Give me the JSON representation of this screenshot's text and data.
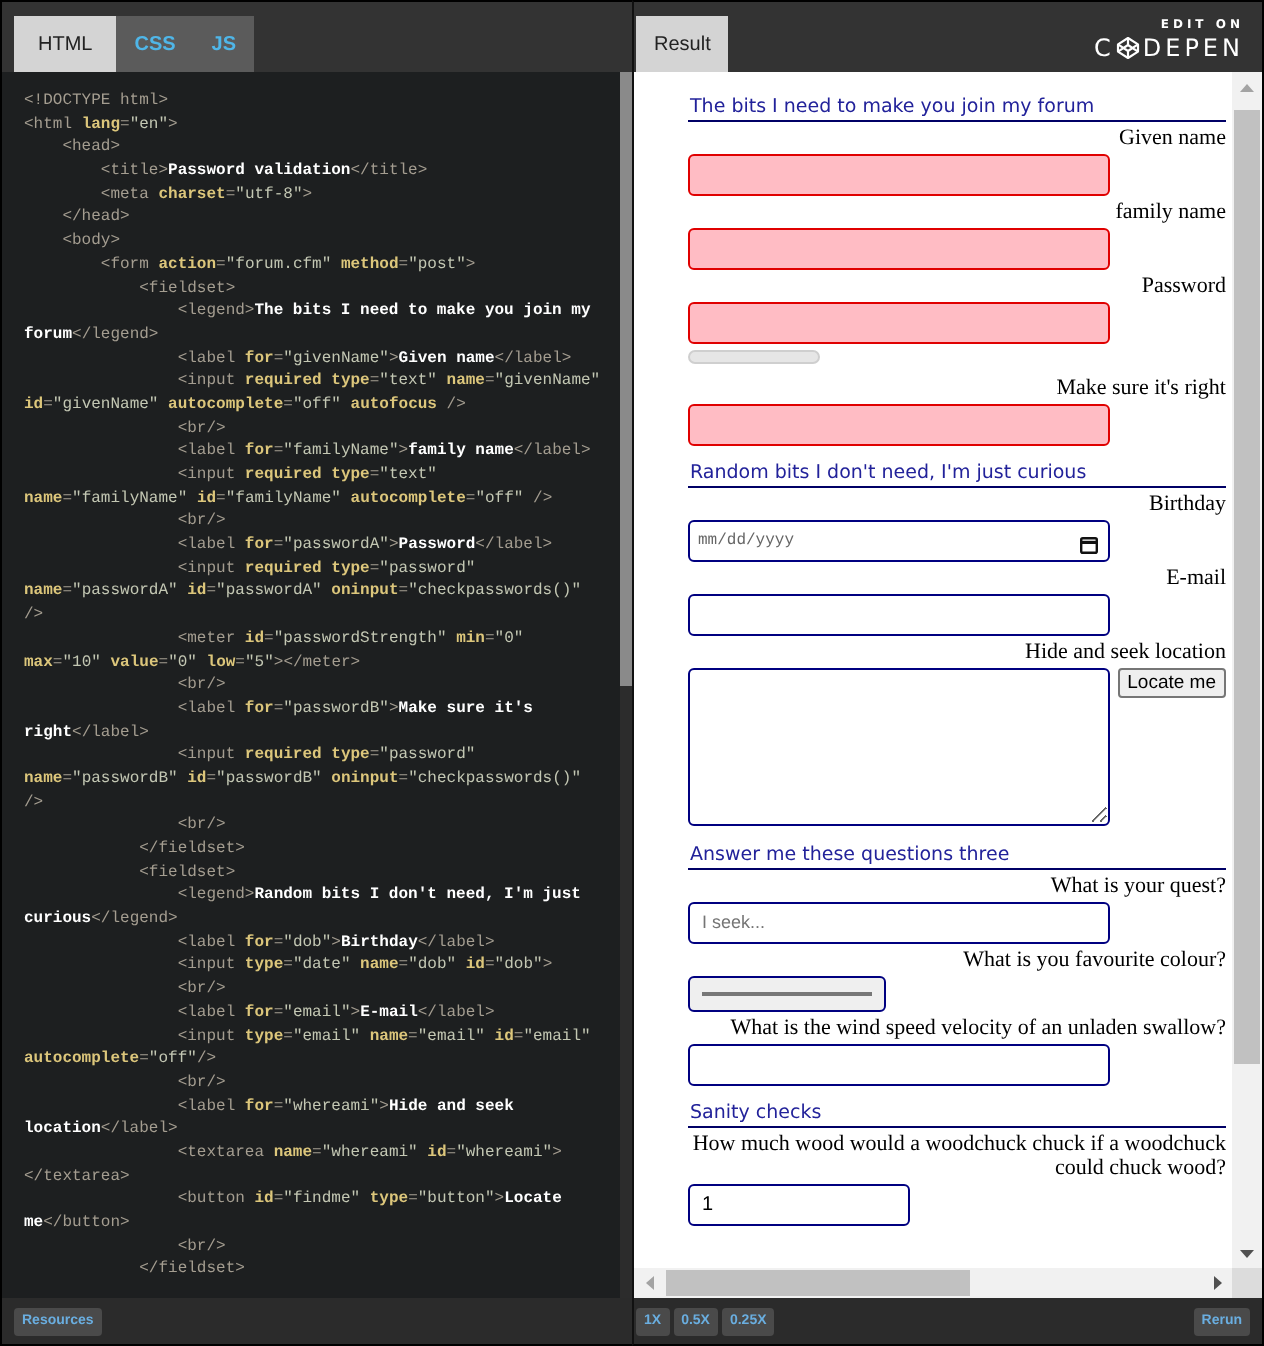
{
  "editor": {
    "tabs": [
      {
        "label": "HTML",
        "selected": true
      },
      {
        "label": "CSS",
        "selected": false
      },
      {
        "label": "JS",
        "selected": false
      }
    ],
    "code_lines": [
      [
        {
          "kind": "tag",
          "text": "<!DOCTYPE html>"
        }
      ],
      [
        {
          "kind": "tag",
          "text": "<html "
        },
        {
          "kind": "attr",
          "text": "lang"
        },
        {
          "kind": "tag",
          "text": "="
        },
        {
          "kind": "str",
          "text": "\"en\""
        },
        {
          "kind": "tag",
          "text": ">"
        }
      ],
      [
        {
          "kind": "tag",
          "text": "    <head>"
        }
      ],
      [
        {
          "kind": "tag",
          "text": "        <title>"
        },
        {
          "kind": "text",
          "text": "Password validation"
        },
        {
          "kind": "tag",
          "text": "</title>"
        }
      ],
      [
        {
          "kind": "tag",
          "text": "        <meta "
        },
        {
          "kind": "attr",
          "text": "charset"
        },
        {
          "kind": "tag",
          "text": "="
        },
        {
          "kind": "str",
          "text": "\"utf-8\""
        },
        {
          "kind": "tag",
          "text": ">"
        }
      ],
      [
        {
          "kind": "tag",
          "text": "    </head>"
        }
      ],
      [
        {
          "kind": "tag",
          "text": "    <body>"
        }
      ],
      [
        {
          "kind": "tag",
          "text": "        <form "
        },
        {
          "kind": "attr",
          "text": "action"
        },
        {
          "kind": "tag",
          "text": "="
        },
        {
          "kind": "str",
          "text": "\"forum.cfm\" "
        },
        {
          "kind": "attr",
          "text": "method"
        },
        {
          "kind": "tag",
          "text": "="
        },
        {
          "kind": "str",
          "text": "\"post\""
        },
        {
          "kind": "tag",
          "text": ">"
        }
      ],
      [
        {
          "kind": "tag",
          "text": "            <fieldset>"
        }
      ],
      [
        {
          "kind": "tag",
          "text": "                <legend>"
        },
        {
          "kind": "text",
          "text": "The bits I need to make you join my"
        }
      ],
      [
        {
          "kind": "text",
          "text": "forum"
        },
        {
          "kind": "tag",
          "text": "</legend>"
        }
      ],
      [
        {
          "kind": "tag",
          "text": "                <label "
        },
        {
          "kind": "attr",
          "text": "for"
        },
        {
          "kind": "tag",
          "text": "="
        },
        {
          "kind": "str",
          "text": "\"givenName\""
        },
        {
          "kind": "tag",
          "text": ">"
        },
        {
          "kind": "text",
          "text": "Given name"
        },
        {
          "kind": "tag",
          "text": "</label>"
        }
      ],
      [
        {
          "kind": "tag",
          "text": "                <input "
        },
        {
          "kind": "attr",
          "text": "required "
        },
        {
          "kind": "attr",
          "text": "type"
        },
        {
          "kind": "tag",
          "text": "="
        },
        {
          "kind": "str",
          "text": "\"text\" "
        },
        {
          "kind": "attr",
          "text": "name"
        },
        {
          "kind": "tag",
          "text": "="
        },
        {
          "kind": "str",
          "text": "\"givenName\""
        }
      ],
      [
        {
          "kind": "attr",
          "text": "id"
        },
        {
          "kind": "tag",
          "text": "="
        },
        {
          "kind": "str",
          "text": "\"givenName\" "
        },
        {
          "kind": "attr",
          "text": "autocomplete"
        },
        {
          "kind": "tag",
          "text": "="
        },
        {
          "kind": "str",
          "text": "\"off\" "
        },
        {
          "kind": "attr",
          "text": "autofocus"
        },
        {
          "kind": "tag",
          "text": " />"
        }
      ],
      [
        {
          "kind": "tag",
          "text": "                <br/>"
        }
      ],
      [
        {
          "kind": "tag",
          "text": "                <label "
        },
        {
          "kind": "attr",
          "text": "for"
        },
        {
          "kind": "tag",
          "text": "="
        },
        {
          "kind": "str",
          "text": "\"familyName\""
        },
        {
          "kind": "tag",
          "text": ">"
        },
        {
          "kind": "text",
          "text": "family name"
        },
        {
          "kind": "tag",
          "text": "</label>"
        }
      ],
      [
        {
          "kind": "tag",
          "text": "                <input "
        },
        {
          "kind": "attr",
          "text": "required "
        },
        {
          "kind": "attr",
          "text": "type"
        },
        {
          "kind": "tag",
          "text": "="
        },
        {
          "kind": "str",
          "text": "\"text\""
        }
      ],
      [
        {
          "kind": "attr",
          "text": "name"
        },
        {
          "kind": "tag",
          "text": "="
        },
        {
          "kind": "str",
          "text": "\"familyName\" "
        },
        {
          "kind": "attr",
          "text": "id"
        },
        {
          "kind": "tag",
          "text": "="
        },
        {
          "kind": "str",
          "text": "\"familyName\" "
        },
        {
          "kind": "attr",
          "text": "autocomplete"
        },
        {
          "kind": "tag",
          "text": "="
        },
        {
          "kind": "str",
          "text": "\"off\""
        },
        {
          "kind": "tag",
          "text": " />"
        }
      ],
      [
        {
          "kind": "tag",
          "text": "                <br/>"
        }
      ],
      [
        {
          "kind": "tag",
          "text": "                <label "
        },
        {
          "kind": "attr",
          "text": "for"
        },
        {
          "kind": "tag",
          "text": "="
        },
        {
          "kind": "str",
          "text": "\"passwordA\""
        },
        {
          "kind": "tag",
          "text": ">"
        },
        {
          "kind": "text",
          "text": "Password"
        },
        {
          "kind": "tag",
          "text": "</label>"
        }
      ],
      [
        {
          "kind": "tag",
          "text": "                <input "
        },
        {
          "kind": "attr",
          "text": "required "
        },
        {
          "kind": "attr",
          "text": "type"
        },
        {
          "kind": "tag",
          "text": "="
        },
        {
          "kind": "str",
          "text": "\"password\""
        }
      ],
      [
        {
          "kind": "attr",
          "text": "name"
        },
        {
          "kind": "tag",
          "text": "="
        },
        {
          "kind": "str",
          "text": "\"passwordA\" "
        },
        {
          "kind": "attr",
          "text": "id"
        },
        {
          "kind": "tag",
          "text": "="
        },
        {
          "kind": "str",
          "text": "\"passwordA\" "
        },
        {
          "kind": "attr",
          "text": "oninput"
        },
        {
          "kind": "tag",
          "text": "="
        },
        {
          "kind": "str",
          "text": "\"checkpasswords()\""
        }
      ],
      [
        {
          "kind": "tag",
          "text": "/>"
        }
      ],
      [
        {
          "kind": "tag",
          "text": "                <meter "
        },
        {
          "kind": "attr",
          "text": "id"
        },
        {
          "kind": "tag",
          "text": "="
        },
        {
          "kind": "str",
          "text": "\"passwordStrength\" "
        },
        {
          "kind": "attr",
          "text": "min"
        },
        {
          "kind": "tag",
          "text": "="
        },
        {
          "kind": "str",
          "text": "\"0\""
        }
      ],
      [
        {
          "kind": "attr",
          "text": "max"
        },
        {
          "kind": "tag",
          "text": "="
        },
        {
          "kind": "str",
          "text": "\"10\" "
        },
        {
          "kind": "attr",
          "text": "value"
        },
        {
          "kind": "tag",
          "text": "="
        },
        {
          "kind": "str",
          "text": "\"0\" "
        },
        {
          "kind": "attr",
          "text": "low"
        },
        {
          "kind": "tag",
          "text": "="
        },
        {
          "kind": "str",
          "text": "\"5\""
        },
        {
          "kind": "tag",
          "text": "></meter>"
        }
      ],
      [
        {
          "kind": "tag",
          "text": "                <br/>"
        }
      ],
      [
        {
          "kind": "tag",
          "text": "                <label "
        },
        {
          "kind": "attr",
          "text": "for"
        },
        {
          "kind": "tag",
          "text": "="
        },
        {
          "kind": "str",
          "text": "\"passwordB\""
        },
        {
          "kind": "tag",
          "text": ">"
        },
        {
          "kind": "text",
          "text": "Make sure it's"
        }
      ],
      [
        {
          "kind": "text",
          "text": "right"
        },
        {
          "kind": "tag",
          "text": "</label>"
        }
      ],
      [
        {
          "kind": "tag",
          "text": "                <input "
        },
        {
          "kind": "attr",
          "text": "required "
        },
        {
          "kind": "attr",
          "text": "type"
        },
        {
          "kind": "tag",
          "text": "="
        },
        {
          "kind": "str",
          "text": "\"password\""
        }
      ],
      [
        {
          "kind": "attr",
          "text": "name"
        },
        {
          "kind": "tag",
          "text": "="
        },
        {
          "kind": "str",
          "text": "\"passwordB\" "
        },
        {
          "kind": "attr",
          "text": "id"
        },
        {
          "kind": "tag",
          "text": "="
        },
        {
          "kind": "str",
          "text": "\"passwordB\" "
        },
        {
          "kind": "attr",
          "text": "oninput"
        },
        {
          "kind": "tag",
          "text": "="
        },
        {
          "kind": "str",
          "text": "\"checkpasswords()\""
        }
      ],
      [
        {
          "kind": "tag",
          "text": "/>"
        }
      ],
      [
        {
          "kind": "tag",
          "text": "                <br/>"
        }
      ],
      [
        {
          "kind": "tag",
          "text": "            </fieldset>"
        }
      ],
      [
        {
          "kind": "tag",
          "text": "            <fieldset>"
        }
      ],
      [
        {
          "kind": "tag",
          "text": "                <legend>"
        },
        {
          "kind": "text",
          "text": "Random bits I don't need, I'm just"
        }
      ],
      [
        {
          "kind": "text",
          "text": "curious"
        },
        {
          "kind": "tag",
          "text": "</legend>"
        }
      ],
      [
        {
          "kind": "tag",
          "text": "                <label "
        },
        {
          "kind": "attr",
          "text": "for"
        },
        {
          "kind": "tag",
          "text": "="
        },
        {
          "kind": "str",
          "text": "\"dob\""
        },
        {
          "kind": "tag",
          "text": ">"
        },
        {
          "kind": "text",
          "text": "Birthday"
        },
        {
          "kind": "tag",
          "text": "</label>"
        }
      ],
      [
        {
          "kind": "tag",
          "text": "                <input "
        },
        {
          "kind": "attr",
          "text": "type"
        },
        {
          "kind": "tag",
          "text": "="
        },
        {
          "kind": "str",
          "text": "\"date\" "
        },
        {
          "kind": "attr",
          "text": "name"
        },
        {
          "kind": "tag",
          "text": "="
        },
        {
          "kind": "str",
          "text": "\"dob\" "
        },
        {
          "kind": "attr",
          "text": "id"
        },
        {
          "kind": "tag",
          "text": "="
        },
        {
          "kind": "str",
          "text": "\"dob\""
        },
        {
          "kind": "tag",
          "text": ">"
        }
      ],
      [
        {
          "kind": "tag",
          "text": "                <br/>"
        }
      ],
      [
        {
          "kind": "tag",
          "text": "                <label "
        },
        {
          "kind": "attr",
          "text": "for"
        },
        {
          "kind": "tag",
          "text": "="
        },
        {
          "kind": "str",
          "text": "\"email\""
        },
        {
          "kind": "tag",
          "text": ">"
        },
        {
          "kind": "text",
          "text": "E-mail"
        },
        {
          "kind": "tag",
          "text": "</label>"
        }
      ],
      [
        {
          "kind": "tag",
          "text": "                <input "
        },
        {
          "kind": "attr",
          "text": "type"
        },
        {
          "kind": "tag",
          "text": "="
        },
        {
          "kind": "str",
          "text": "\"email\" "
        },
        {
          "kind": "attr",
          "text": "name"
        },
        {
          "kind": "tag",
          "text": "="
        },
        {
          "kind": "str",
          "text": "\"email\" "
        },
        {
          "kind": "attr",
          "text": "id"
        },
        {
          "kind": "tag",
          "text": "="
        },
        {
          "kind": "str",
          "text": "\"email\""
        }
      ],
      [
        {
          "kind": "attr",
          "text": "autocomplete"
        },
        {
          "kind": "tag",
          "text": "="
        },
        {
          "kind": "str",
          "text": "\"off\""
        },
        {
          "kind": "tag",
          "text": "/>"
        }
      ],
      [
        {
          "kind": "tag",
          "text": "                <br/>"
        }
      ],
      [
        {
          "kind": "tag",
          "text": "                <label "
        },
        {
          "kind": "attr",
          "text": "for"
        },
        {
          "kind": "tag",
          "text": "="
        },
        {
          "kind": "str",
          "text": "\"whereami\""
        },
        {
          "kind": "tag",
          "text": ">"
        },
        {
          "kind": "text",
          "text": "Hide and seek"
        }
      ],
      [
        {
          "kind": "text",
          "text": "location"
        },
        {
          "kind": "tag",
          "text": "</label>"
        }
      ],
      [
        {
          "kind": "tag",
          "text": "                <textarea "
        },
        {
          "kind": "attr",
          "text": "name"
        },
        {
          "kind": "tag",
          "text": "="
        },
        {
          "kind": "str",
          "text": "\"whereami\" "
        },
        {
          "kind": "attr",
          "text": "id"
        },
        {
          "kind": "tag",
          "text": "="
        },
        {
          "kind": "str",
          "text": "\"whereami\""
        },
        {
          "kind": "tag",
          "text": ">"
        }
      ],
      [
        {
          "kind": "tag",
          "text": "</textarea>"
        }
      ],
      [
        {
          "kind": "tag",
          "text": "                <button "
        },
        {
          "kind": "attr",
          "text": "id"
        },
        {
          "kind": "tag",
          "text": "="
        },
        {
          "kind": "str",
          "text": "\"findme\" "
        },
        {
          "kind": "attr",
          "text": "type"
        },
        {
          "kind": "tag",
          "text": "="
        },
        {
          "kind": "str",
          "text": "\"button\""
        },
        {
          "kind": "tag",
          "text": ">"
        },
        {
          "kind": "text",
          "text": "Locate"
        }
      ],
      [
        {
          "kind": "text",
          "text": "me"
        },
        {
          "kind": "tag",
          "text": "</button>"
        }
      ],
      [
        {
          "kind": "tag",
          "text": "                <br/>"
        }
      ],
      [
        {
          "kind": "tag",
          "text": "            </fieldset>"
        }
      ]
    ],
    "resources_button": "Resources"
  },
  "result": {
    "tabs": [
      {
        "label": "Result",
        "selected": true
      }
    ],
    "edit_on": "EDIT ON",
    "logo_left": "C",
    "logo_right": "DEPEN",
    "fieldsets": [
      {
        "legend": "The bits I need to make you join my forum",
        "fields": [
          {
            "kind": "input",
            "label": "Given name",
            "invalid": true
          },
          {
            "kind": "input",
            "label": "family name",
            "invalid": true
          },
          {
            "kind": "input",
            "label": "Password",
            "invalid": true
          },
          {
            "kind": "meter",
            "level": 0
          },
          {
            "kind": "input",
            "label": "Make sure it's right",
            "invalid": true
          }
        ]
      },
      {
        "legend": "Random bits I don't need, I'm just curious",
        "fields": [
          {
            "kind": "date",
            "label": "Birthday",
            "placeholder": "mm/dd/yyyy",
            "invalid": false
          },
          {
            "kind": "input",
            "label": "E-mail",
            "invalid": false
          },
          {
            "kind": "textarea",
            "label": "Hide and seek location",
            "button": "Locate me",
            "invalid": false
          }
        ]
      },
      {
        "legend": "Answer me these questions three",
        "fields": [
          {
            "kind": "input",
            "label": "What is your quest?",
            "placeholder": "I seek...",
            "invalid": false
          },
          {
            "kind": "color",
            "label": "What is you favourite colour?"
          },
          {
            "kind": "input",
            "label": "What is the wind speed velocity of an unladen swallow?",
            "invalid": false
          }
        ]
      },
      {
        "legend": "Sanity checks",
        "fields": [
          {
            "kind": "number",
            "label": "How much wood would a woodchuck chuck if a woodchuck could chuck wood?",
            "value": "1",
            "invalid": false
          }
        ]
      }
    ],
    "zoom_buttons": [
      "1X",
      "0.5X",
      "0.25X"
    ],
    "rerun_button": "Rerun"
  }
}
